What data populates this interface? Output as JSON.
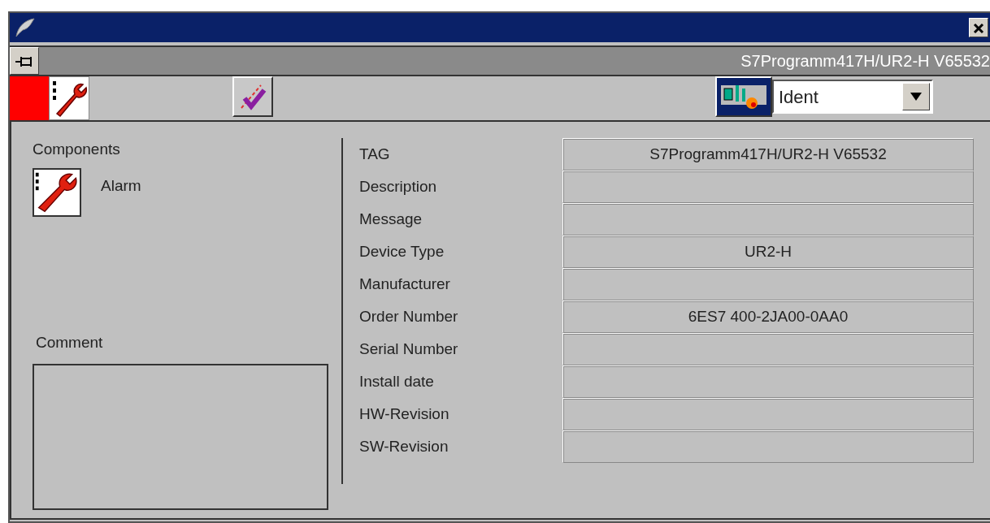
{
  "header": {
    "object_path": "S7Programm417H/UR2-H V65532"
  },
  "view_select": {
    "value": "Ident"
  },
  "components": {
    "title": "Components",
    "items": [
      {
        "label": "Alarm"
      }
    ]
  },
  "comment": {
    "title": "Comment"
  },
  "fields": [
    {
      "label": "TAG",
      "value": "S7Programm417H/UR2-H V65532"
    },
    {
      "label": "Description"
    },
    {
      "label": "Message"
    },
    {
      "label": "Device Type",
      "value": "UR2-H"
    },
    {
      "label": "Manufacturer"
    },
    {
      "label": "Order Number",
      "value": "6ES7 400-2JA00-0AA0"
    },
    {
      "label": "Serial Number"
    },
    {
      "label": "Install date"
    },
    {
      "label": "HW-Revision"
    },
    {
      "label": "SW-Revision"
    }
  ]
}
